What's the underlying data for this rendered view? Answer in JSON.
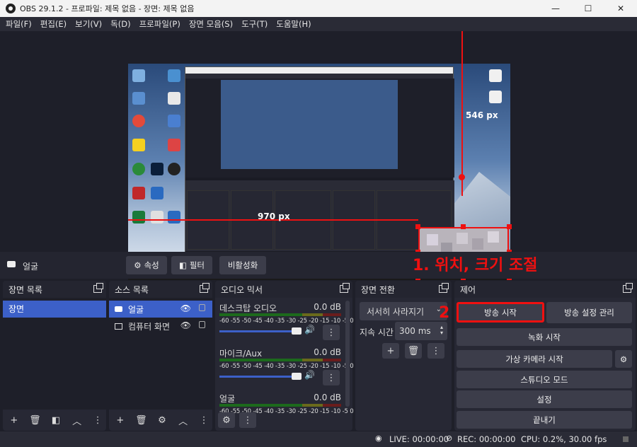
{
  "window": {
    "title": "OBS 29.1.2 - 프로파일: 제목 없음 - 장면: 제목 없음",
    "minimize": "—",
    "maximize": "☐",
    "close": "✕"
  },
  "menu": [
    "파일(F)",
    "편집(E)",
    "보기(V)",
    "독(D)",
    "프로파일(P)",
    "장면 모음(S)",
    "도구(T)",
    "도움말(H)"
  ],
  "preview": {
    "label_height": "546 px",
    "label_width": "970 px"
  },
  "source_bar": {
    "source_name": "얼굴",
    "properties": "속성",
    "filters": "필터",
    "deactivate": "비활성화"
  },
  "annotations": {
    "step1": "1. 위치, 크기 조절",
    "step2": "2"
  },
  "scenes": {
    "title": "장면 목록",
    "items": [
      "장면"
    ]
  },
  "sources": {
    "title": "소스 목록",
    "items": [
      {
        "name": "얼굴",
        "icon": "camera-icon",
        "selected": true
      },
      {
        "name": "컴퓨터 화면",
        "icon": "monitor-icon",
        "selected": false
      }
    ]
  },
  "mixer": {
    "title": "오디오 믹서",
    "ticks": "-60 -55 -50 -45 -40 -35 -30 -25 -20 -15 -10 -5 0",
    "channels": [
      {
        "name": "데스크탑 오디오",
        "db": "0.0 dB"
      },
      {
        "name": "마이크/Aux",
        "db": "0.0 dB"
      },
      {
        "name": "얼굴",
        "db": "0.0 dB"
      }
    ]
  },
  "transitions": {
    "title": "장면 전환",
    "selected": "서서히 사라지기",
    "duration_label": "지속 시간",
    "duration_value": "300 ms"
  },
  "controls": {
    "title": "제어",
    "start_stream": "방송 시작",
    "stream_settings": "방송 설정 관리",
    "start_recording": "녹화 시작",
    "virtual_camera": "가상 카메라 시작",
    "studio_mode": "스튜디오 모드",
    "settings": "설정",
    "exit": "끝내기"
  },
  "status": {
    "live": "LIVE: 00:00:00",
    "rec": "REC: 00:00:00",
    "cpu": "CPU: 0.2%, 30.00 fps"
  },
  "colors": {
    "accent": "#3c60c8",
    "annotation_red": "#f01010"
  }
}
